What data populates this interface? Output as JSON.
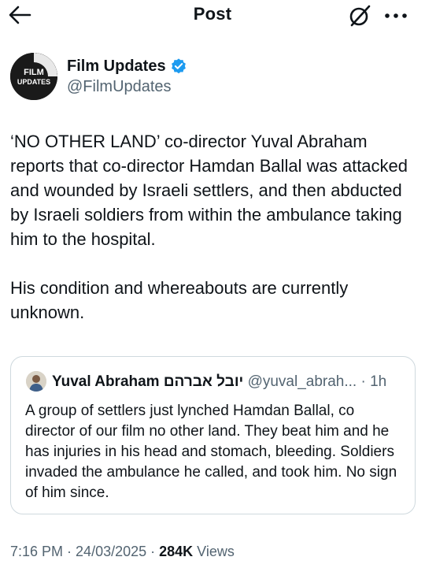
{
  "header": {
    "title": "Post",
    "back_icon": "arrow-left-icon",
    "grok_icon": "grok-icon",
    "more_icon": "more-dots-icon"
  },
  "post": {
    "author": {
      "name": "Film Updates",
      "handle": "@FilmUpdates",
      "avatar_text_1": "FILM",
      "avatar_text_2": "UPDATES",
      "verified_color": "#1d9bf0"
    },
    "text": "‘NO OTHER LAND’ co-director Yuval Abraham reports that co-director Hamdan Ballal was attacked and wounded by Israeli settlers, and then abducted by Israeli soldiers from within the ambulance taking him to the hospital.\n\nHis condition and whereabouts are currently unknown.",
    "quote": {
      "name": "Yuval Abraham יובל אברהם",
      "handle": "@yuval_abrah...",
      "time": "· 1h",
      "text": "A group of settlers just lynched Hamdan Ballal, co director of our film no other land. They beat him and he has injuries in his head and stomach, bleeding. Soldiers invaded the ambulance he called, and took him. No sign of him since."
    },
    "meta": {
      "time": "7:16 PM",
      "sep1": " · ",
      "date": "24/03/2025",
      "sep2": " · ",
      "views_count": "284K",
      "views_label": " Views"
    }
  }
}
